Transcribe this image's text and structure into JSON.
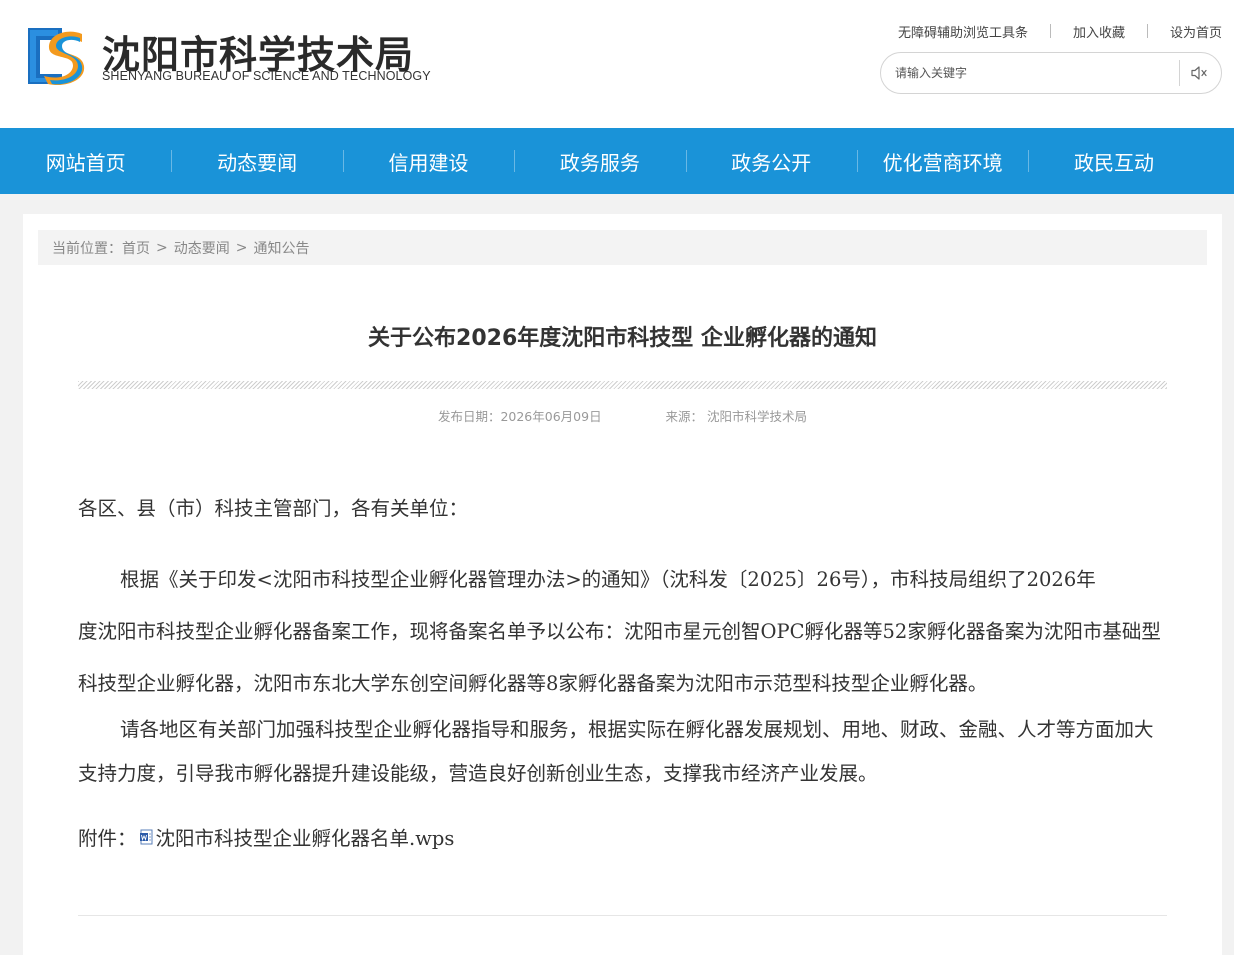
{
  "header": {
    "logo_cn": "沈阳市科学技术局",
    "logo_en": "SHENYANG BUREAU OF SCIENCE AND TECHNOLOGY",
    "links": {
      "accessibility": "无障碍辅助浏览工具条",
      "favorite": "加入收藏",
      "homepage": "设为首页"
    },
    "search": {
      "placeholder": "请输入关键字",
      "value": ""
    },
    "brand_colors": {
      "blue": "#1a93d8",
      "orange": "#f39a1e"
    }
  },
  "nav": {
    "items": [
      "网站首页",
      "动态要闻",
      "信用建设",
      "政务服务",
      "政务公开",
      "优化营商环境",
      "政民互动"
    ]
  },
  "breadcrumb": {
    "label": "当前位置：",
    "home": "首页",
    "section": "动态要闻",
    "current": "通知公告",
    "separator": ">"
  },
  "article": {
    "title": "关于公布2026年度沈阳市科技型 企业孵化器的通知",
    "date_label": "发布日期：",
    "date": "2026年06月09日",
    "source_label": "来源：",
    "source": "沈阳市科学技术局",
    "greeting": "各区、县（市）科技主管部门，各有关单位：",
    "para1_line1": "根据《关于印发<沈阳市科技型企业孵化器管理办法>的通知》（沈科发〔2025〕26号），市科技局组织了2026年",
    "para1_line2": "度沈阳市科技型企业孵化器备案工作，现将备案名单予以公布：沈阳市星元创智OPC孵化器等52家孵化器备案为沈阳市基础型科技型企业孵化器，沈阳市东北大学东创空间孵化器等8家孵化器备案为沈阳市示范型科技型企业孵化器。",
    "para2": "请各地区有关部门加强科技型企业孵化器指导和服务，根据实际在孵化器发展规划、用地、财政、金融、人才等方面加大支持力度，引导我市孵化器提升建设能级，营造良好创新创业生态，支撑我市经济产业发展。",
    "attachment_label": "附件：",
    "attachment_file": "沈阳市科技型企业孵化器名单.wps"
  }
}
